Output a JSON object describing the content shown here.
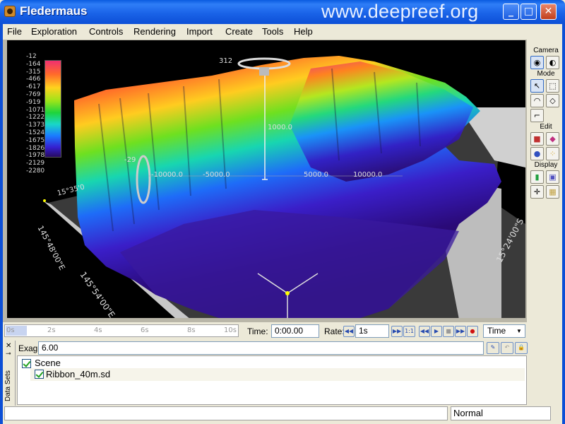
{
  "window": {
    "title": "Fledermaus",
    "watermark": "www.deepreef.org",
    "controls": {
      "minimize": "_",
      "maximize": "□",
      "close": "✕"
    }
  },
  "menu": [
    "File",
    "Exploration",
    "Controls",
    "Rendering",
    "Import",
    "Create",
    "Tools",
    "Help"
  ],
  "viewport": {
    "legend": {
      "values": [
        "-12",
        "-164",
        "-315",
        "-466",
        "-617",
        "-769",
        "-919",
        "-1071",
        "-1222",
        "-1373",
        "-1524",
        "-1675",
        "-1826",
        "-1978",
        "-2129",
        "-2280"
      ],
      "colors": [
        "#f03070",
        "#ff6a2a",
        "#ffd21e",
        "#9ae41a",
        "#1ed43c",
        "#19d7c8",
        "#1a7cff",
        "#3520d0",
        "#280a60"
      ]
    },
    "ring_top_label": "312",
    "ring_left_label": "-29",
    "vertical_scale_label": "1000.0",
    "axis_labels": [
      "-10000.0",
      "-5000.0",
      "5000.0",
      "10000.0"
    ],
    "coord_labels": {
      "left_vertical": "145°48'00\"E",
      "left_bottom": "145°54'00\"E",
      "right": "15°24'00\"S",
      "top_left": "15°35'0"
    }
  },
  "tools": {
    "camera_label": "Camera",
    "mode_label": "Mode",
    "edit_label": "Edit",
    "display_label": "Display",
    "icons": [
      "camera-rotate-icon",
      "camera-fly-icon",
      "pointer-icon",
      "select-box-icon",
      "lasso-icon",
      "polygon-select-icon",
      "profile-icon",
      "edit-color-icon",
      "edit-shape-icon",
      "edit-fill-icon",
      "edit-points-icon",
      "display-legend-icon",
      "display-volume-icon",
      "display-grid-icon",
      "display-image-icon"
    ]
  },
  "timeline": {
    "ticks": [
      "0s",
      "2s",
      "4s",
      "6s",
      "8s",
      "10s"
    ],
    "time_label": "Time:",
    "time_value": "0:00.00",
    "rate_label": "Rate:",
    "rate_value": "1s",
    "ratio_label": "1:1",
    "mode_select": "Time"
  },
  "data_panel": {
    "side_label": "Data Sets",
    "exag_label": "Exag:",
    "exag_value": "6.00",
    "tree": [
      {
        "label": "Scene",
        "checked": true
      },
      {
        "label": "Ribbon_40m.sd",
        "checked": true
      }
    ]
  },
  "status": {
    "left": "",
    "right": "Normal"
  }
}
